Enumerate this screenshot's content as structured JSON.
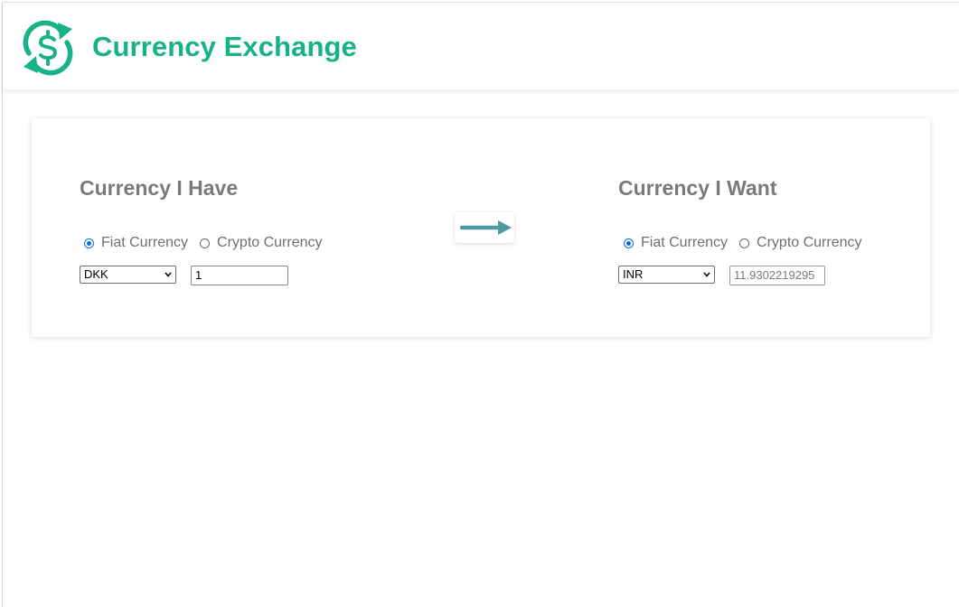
{
  "header": {
    "title": "Currency Exchange",
    "logo_icon": "dollar-exchange-icon"
  },
  "have": {
    "title": "Currency I Have",
    "radio_fiat": "Fiat Currency",
    "radio_crypto": "Crypto Currency",
    "selected_type": "fiat",
    "currency": "DKK",
    "amount": "1"
  },
  "want": {
    "title": "Currency I Want",
    "radio_fiat": "Fiat Currency",
    "radio_crypto": "Crypto Currency",
    "selected_type": "fiat",
    "currency": "INR",
    "amount": "11.9302219295"
  },
  "swap": {
    "icon": "arrow-right-icon"
  },
  "colors": {
    "brand": "#19b186",
    "arrow": "#4f9aa0",
    "heading": "#7a7a7a",
    "radio_selected": "#0b6bd6"
  }
}
